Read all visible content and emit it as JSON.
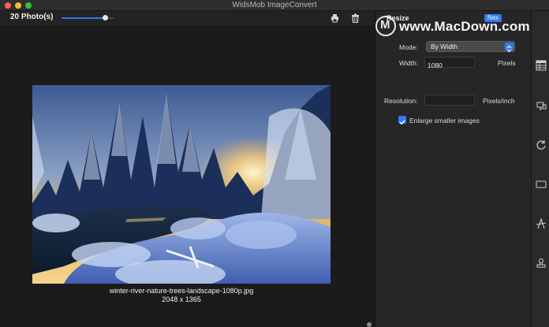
{
  "window": {
    "title": "WidsMob ImageConvert"
  },
  "toolbar": {
    "photo_count": "20 Photo(s)",
    "zoom_fraction": 0.88,
    "icons": [
      "print-icon",
      "trash-icon"
    ]
  },
  "preview": {
    "file_name": "winter-river-nature-trees-landscape-1080p.jpg",
    "dimensions": "2048 x 1365"
  },
  "panel": {
    "tab_label": "Resize",
    "next_label": "Nex",
    "watermark": "www.MacDown.com",
    "watermark_logo": "M",
    "mode_label": "Mode:",
    "mode_value": "By Width",
    "width_label": "Width:",
    "width_value": "1080",
    "width_unit": "Pixels",
    "resolution_label": "Resolution:",
    "resolution_value": "",
    "resolution_unit": "Pixels/inch",
    "enlarge_label": "Enlarge smaller images",
    "enlarge_checked": true
  },
  "sidebar": {
    "icons": [
      "resize-icon",
      "format-icon",
      "rotate-icon",
      "crop-icon",
      "text-watermark-icon",
      "stamp-icon"
    ]
  },
  "colors": {
    "accent": "#2f7cf6",
    "background": "#1e1e1e",
    "panel": "#262626"
  }
}
